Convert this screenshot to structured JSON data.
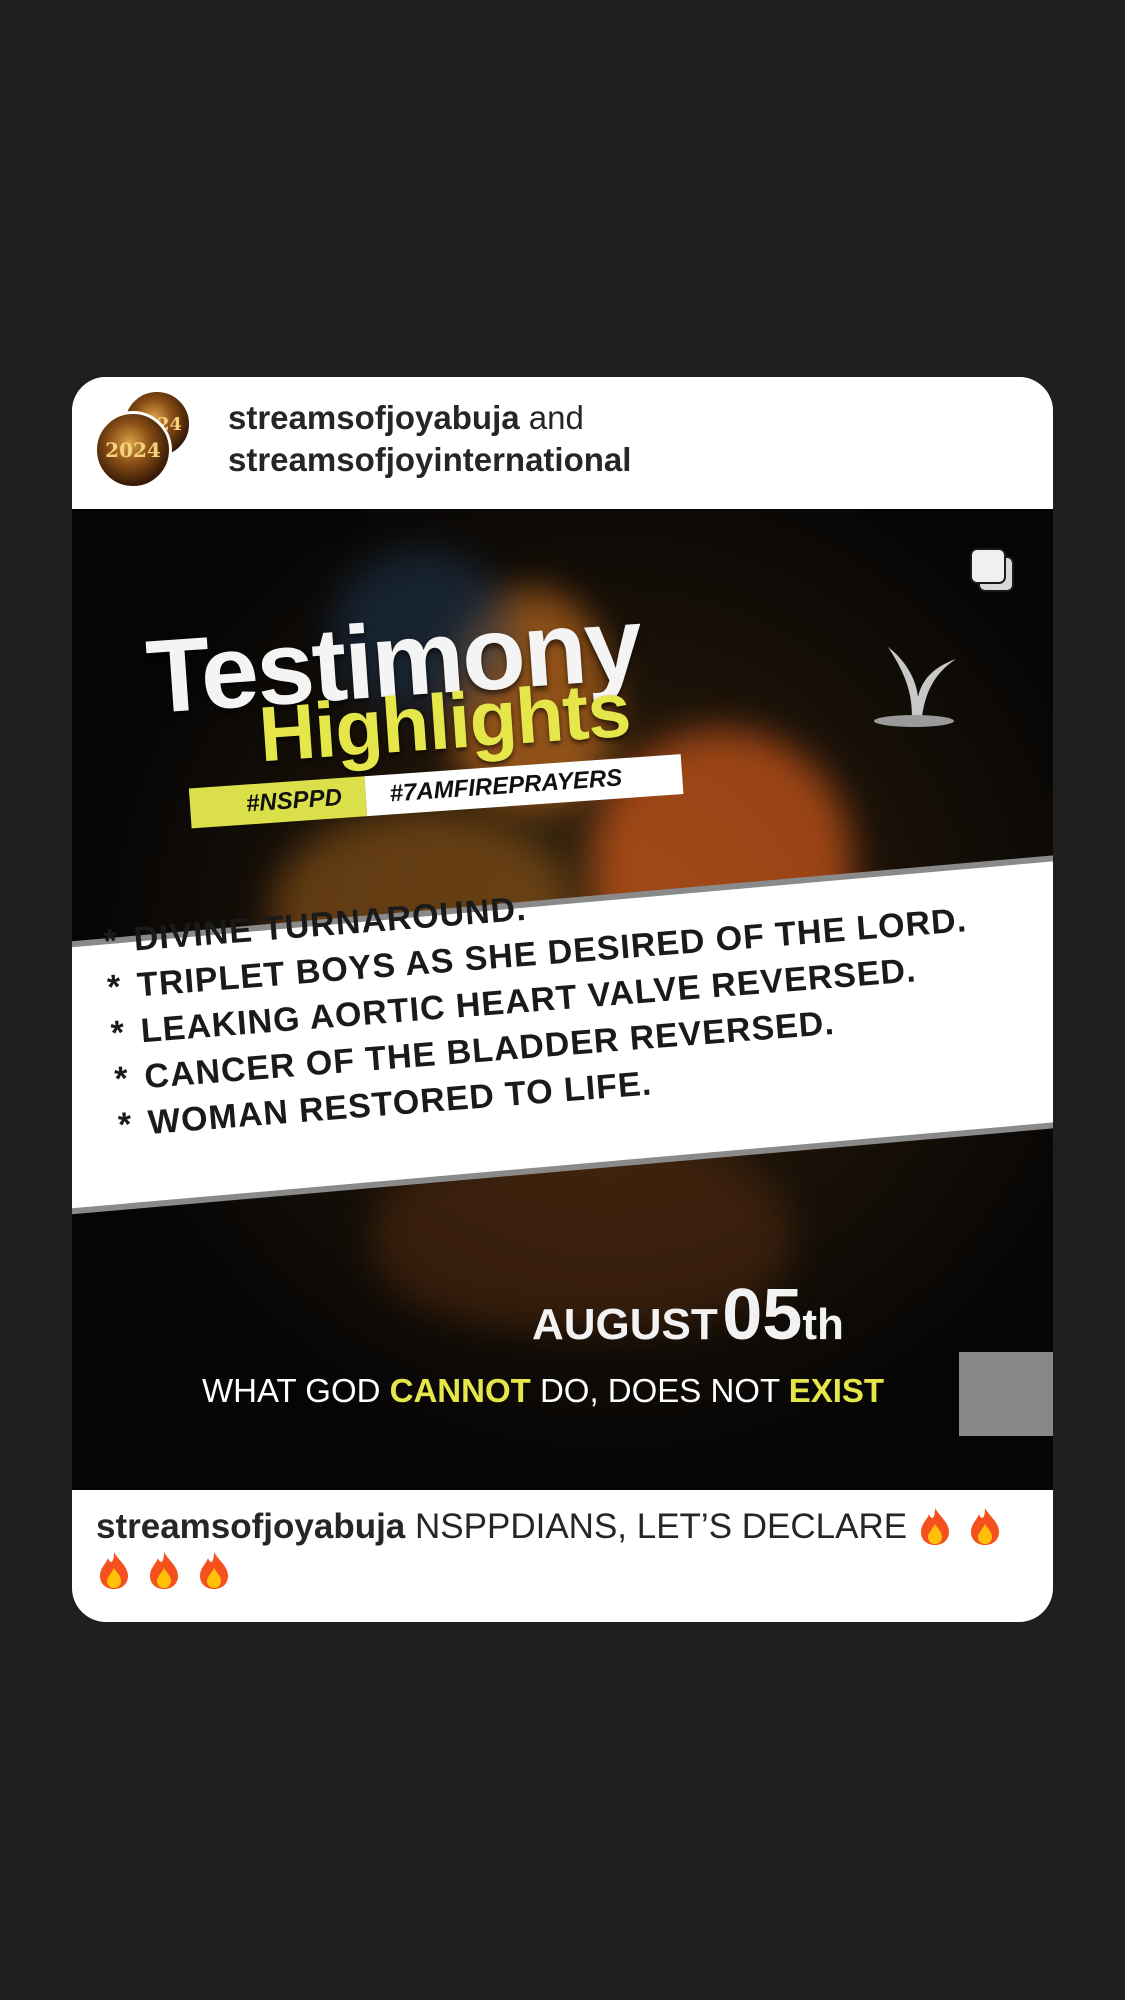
{
  "header": {
    "account_1": "streamsofjoyabuja",
    "connector": "and",
    "account_2": "streamsofjoyinternational"
  },
  "avatar": {
    "text": "2024"
  },
  "post": {
    "title_line1": "Testimony",
    "title_line2": "Highlights",
    "tag_1": "#NSPPD",
    "tag_2": "#7AMFIREPRAYERS",
    "testimonies": [
      "DIVINE TURNAROUND.",
      "TRIPLET BOYS AS SHE DESIRED OF THE LORD.",
      "LEAKING AORTIC HEART VALVE REVERSED.",
      "CANCER OF THE BLADDER REVERSED.",
      "WOMAN RESTORED TO LIFE."
    ],
    "bullet": "*",
    "date_month": "AUGUST",
    "date_day": "05",
    "date_suffix": "th",
    "slogan_1": "WHAT GOD",
    "slogan_2": "CANNOT",
    "slogan_3": "DO, DOES NOT",
    "slogan_4": "EXIST"
  },
  "caption": {
    "username": "streamsofjoyabuja",
    "text": "NSPPDIANS, LET’S DECLARE",
    "emoji_count": 5
  },
  "colors": {
    "background": "#1f1f1f",
    "card": "#ffffff",
    "accent_yellow": "#e4e64a",
    "text": "#262626"
  },
  "icons": {
    "multi_image": "carousel-icon",
    "logo": "plant-logo",
    "emoji": "fire-emoji"
  }
}
